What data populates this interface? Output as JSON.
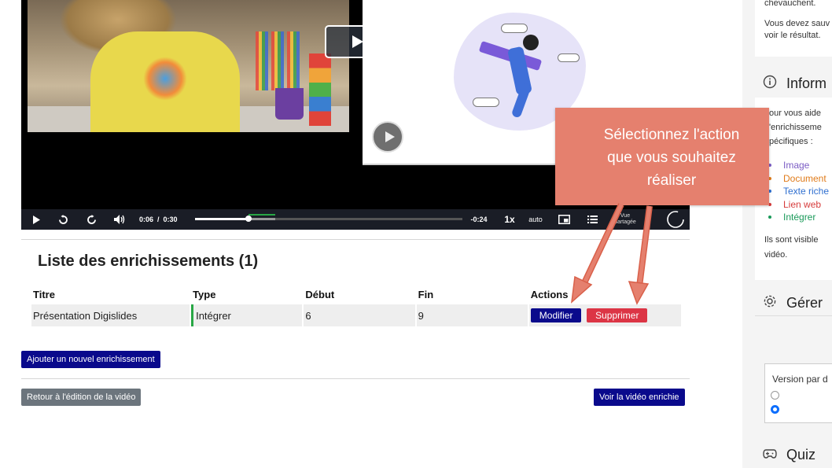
{
  "player": {
    "current_time": "0:06",
    "time_separator": "/",
    "duration": "0:30",
    "remaining": "-0:24",
    "playback_rate": "1x",
    "quality": "auto",
    "shared_label_line1": "Vue",
    "shared_label_line2": "partagée",
    "progress_fraction": 0.2
  },
  "enrichments": {
    "title": "Liste des enrichissements (1)",
    "columns": [
      "Titre",
      "Type",
      "Début",
      "Fin",
      "Actions"
    ],
    "rows": [
      {
        "title": "Présentation Digislides",
        "type": "Intégrer",
        "start": "6",
        "end": "9"
      }
    ],
    "edit_label": "Modifier",
    "delete_label": "Supprimer",
    "add_label": "Ajouter un nouvel enrichissement",
    "back_label": "Retour à l'édition de la vidéo",
    "view_label": "Voir la vidéo enrichie"
  },
  "callout": {
    "line1": "Sélectionnez l'action",
    "line2": "que vous souhaitez",
    "line3": "réaliser"
  },
  "sidebar": {
    "top_text_1": "chevauchent.",
    "top_text_2": "Vous devez sauv",
    "top_text_3": "voir le résultat.",
    "info_heading": "Inform",
    "info_text_1": "our vous aide",
    "info_text_2": "'enrichisseme",
    "info_text_3": "pécifiques :",
    "types": [
      {
        "label": "Image",
        "color": "#7b5cc4"
      },
      {
        "label": "Document",
        "color": "#e07b1a"
      },
      {
        "label": "Texte riche",
        "color": "#2f6fd0"
      },
      {
        "label": "Lien web",
        "color": "#d63b3b"
      },
      {
        "label": "Intégrer",
        "color": "#1a9a5a"
      }
    ],
    "info_text_4": "Ils sont visible",
    "info_text_5": "vidéo.",
    "manage_heading": "Gérer",
    "version_label": "Version par d",
    "quiz_heading": "Quiz"
  },
  "colors": {
    "primary": "#0a0a8c",
    "danger": "#dc3545",
    "secondary": "#6c757d",
    "callout": "#e5806e",
    "type_marker": "#28a745"
  }
}
